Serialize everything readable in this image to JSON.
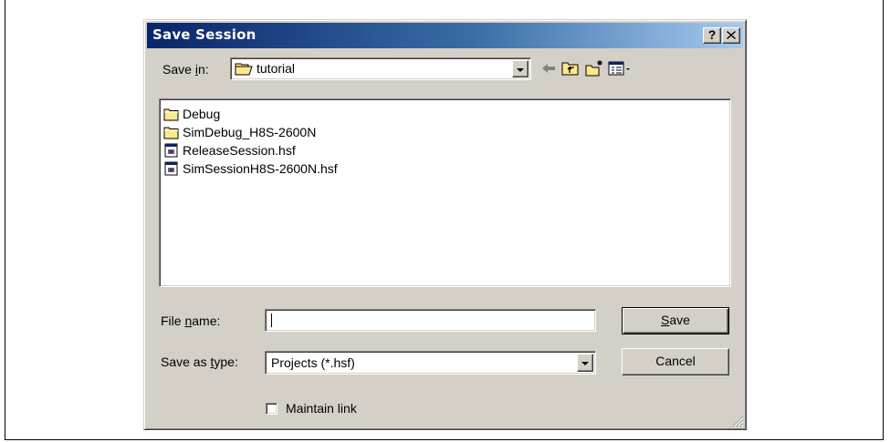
{
  "dialog": {
    "title": "Save Session",
    "help_label": "?",
    "close_label": "✕"
  },
  "save_in": {
    "label_pre": "Save ",
    "label_key": "i",
    "label_post": "n:",
    "value": "tutorial"
  },
  "toolbar": {
    "icons": [
      "back-arrow-icon",
      "up-folder-icon",
      "new-folder-icon",
      "view-menu-icon"
    ]
  },
  "files": [
    {
      "name": "Debug",
      "icon": "folder-icon"
    },
    {
      "name": "SimDebug_H8S-2600N",
      "icon": "folder-icon"
    },
    {
      "name": "ReleaseSession.hsf",
      "icon": "session-file-icon"
    },
    {
      "name": "SimSessionH8S-2600N.hsf",
      "icon": "session-file-icon"
    }
  ],
  "file_name": {
    "label_pre": "File ",
    "label_key": "n",
    "label_post": "ame:",
    "value": ""
  },
  "save_as_type": {
    "label_pre": "Save as ",
    "label_key": "t",
    "label_post": "ype:",
    "value": "Projects (*.hsf)"
  },
  "buttons": {
    "save_key": "S",
    "save_rest": "ave",
    "cancel": "Cancel"
  },
  "maintain_link": {
    "label": "Maintain link",
    "checked": false
  },
  "colors": {
    "titlebar_start": "#0a246a",
    "titlebar_end": "#a6caf0",
    "face": "#d4d0c8",
    "folder": "#ffe88a"
  }
}
